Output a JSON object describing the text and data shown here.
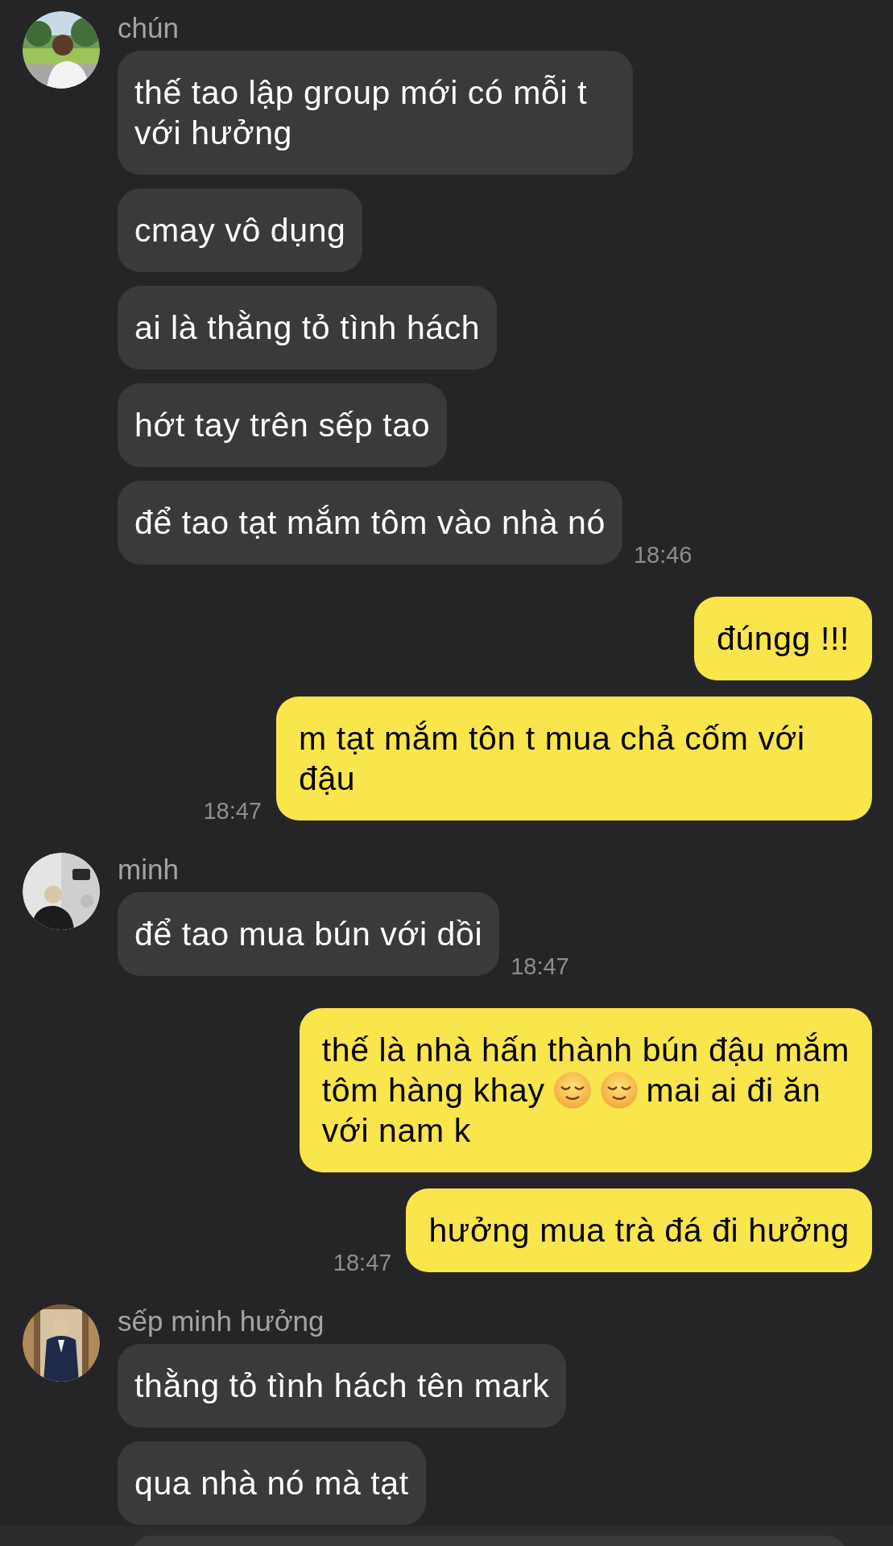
{
  "messages": [
    {
      "kind": "incoming",
      "sender": "chún",
      "time": "18:46",
      "bubbles": [
        {
          "text": "thế tao lập group mới có mỗi t với hưởng"
        },
        {
          "text": "cmay vô dụng"
        },
        {
          "text": "ai là thằng tỏ tình hách"
        },
        {
          "text": "hớt tay trên sếp tao"
        },
        {
          "text": "để tao tạt mắm tôm vào nhà nó"
        }
      ]
    },
    {
      "kind": "outgoing",
      "time": "18:47",
      "bubbles": [
        {
          "text": "đúngg !!!"
        },
        {
          "text": "m tạt mắm tôn t mua chả cốm với đậu"
        }
      ]
    },
    {
      "kind": "incoming",
      "sender": "minh",
      "time": "18:47",
      "bubbles": [
        {
          "text": "để tao mua bún với dồi"
        }
      ]
    },
    {
      "kind": "outgoing",
      "time": "18:47",
      "bubbles": [
        {
          "lines": [
            [
              {
                "kind": "text",
                "text": "thế là nhà hấn thành bún đậu mắm"
              }
            ],
            [
              {
                "kind": "text",
                "text": "tôm hàng khay"
              },
              {
                "kind": "emoji"
              },
              {
                "kind": "emoji"
              },
              {
                "kind": "text",
                "text": "mai ai đi ăn"
              }
            ],
            [
              {
                "kind": "text",
                "text": "với nam k"
              }
            ]
          ]
        },
        {
          "text": "hưởng mua trà đá đi hưởng"
        }
      ]
    },
    {
      "kind": "incoming",
      "sender": "sếp minh hưởng",
      "bubbles": [
        {
          "text": "thằng tỏ tình hách tên mark"
        },
        {
          "text": "qua nhà nó mà tạt"
        }
      ]
    }
  ]
}
